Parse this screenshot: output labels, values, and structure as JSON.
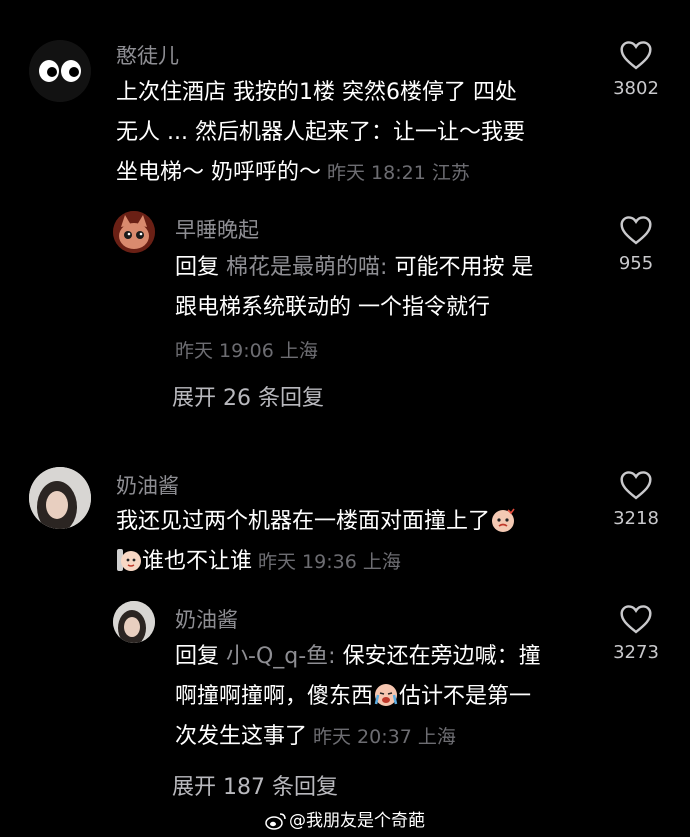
{
  "comments": [
    {
      "username": "憨徒儿",
      "lines": [
        "上次住酒店  我按的1楼 突然6楼停了 四处",
        "无人 ... 然后机器人起来了：让一让～我要",
        "坐电梯～ 奶呼呼的～"
      ],
      "time": "昨天 18:21 江苏",
      "likes": "3802",
      "reply": {
        "username": "早睡晚起",
        "prefix": "回复",
        "reply_to": "棉花是最萌的喵:",
        "lines": [
          "可能不用按 是",
          "跟电梯系统联动的 一个指令就行"
        ],
        "time": "昨天 19:06 上海",
        "likes": "955"
      },
      "expand": "展开 26 条回复"
    },
    {
      "username": "奶油酱",
      "line1": "我还见过两个机器在一楼面对面撞上了",
      "line2": "谁也不让谁",
      "time": "昨天 19:36 上海",
      "likes": "3218",
      "reply": {
        "username": "奶油酱",
        "prefix": "回复",
        "reply_to": "小-Q_q-鱼:",
        "line1_rest": "保安还在旁边喊：撞",
        "line2_a": "啊撞啊撞啊，傻东西",
        "line2_b": "估计不是第一",
        "line3": "次发生这事了",
        "time": "昨天 20:37 上海",
        "likes": "3273"
      },
      "expand": "展开 187 条回复"
    }
  ],
  "watermark": "@我朋友是个奇葩"
}
